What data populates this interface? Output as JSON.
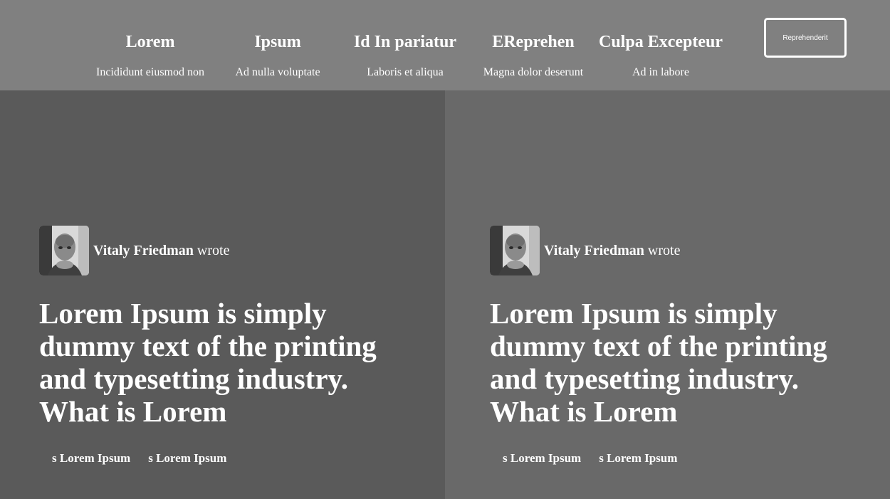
{
  "nav": {
    "items": [
      {
        "title": "Lorem",
        "subtitle": "Incididunt eiusmod non"
      },
      {
        "title": "Ipsum",
        "subtitle": "Ad nulla voluptate"
      },
      {
        "title": "Id In pariatur",
        "subtitle": "Laboris et aliqua"
      },
      {
        "title": "EReprehen",
        "subtitle": "Magna dolor deserunt"
      },
      {
        "title": "Culpa Excepteur",
        "subtitle": "Ad in labore"
      }
    ],
    "cta_label": "Reprehenderit"
  },
  "cards": [
    {
      "author_name": "Vitaly Friedman",
      "author_suffix": " wrote",
      "headline": "Lorem Ipsum is simply dummy text of the printing and typesetting industry. What is Lorem",
      "tags": [
        "s Lorem Ipsum",
        "s Lorem Ipsum"
      ]
    },
    {
      "author_name": "Vitaly Friedman",
      "author_suffix": " wrote",
      "headline": "Lorem Ipsum is simply dummy text of the printing and typesetting industry. What is Lorem",
      "tags": [
        "s Lorem Ipsum",
        "s Lorem Ipsum"
      ]
    }
  ],
  "colors": {
    "header_bg": "#808080",
    "left_panel_bg": "#5a5a5a",
    "right_panel_bg": "#696969",
    "text": "#ffffff"
  }
}
